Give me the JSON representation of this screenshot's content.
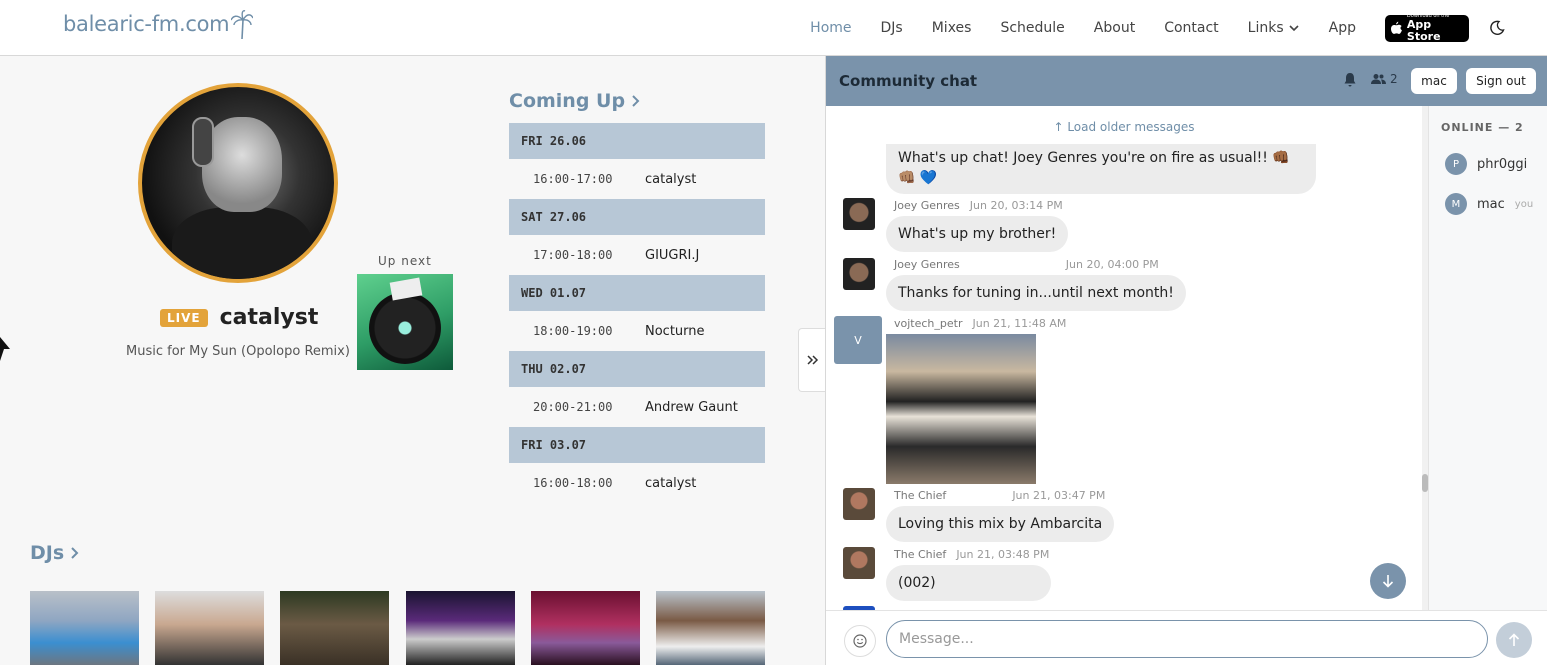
{
  "nav": {
    "logo": "balearic-fm.com",
    "links": [
      "Home",
      "DJs",
      "Mixes",
      "Schedule",
      "About",
      "Contact",
      "Links",
      "App"
    ],
    "appstore_small": "Download on the",
    "appstore_big": "App Store"
  },
  "now_playing": {
    "live_badge": "LIVE",
    "dj": "catalyst",
    "track": "Music for My Sun (Opolopo Remix)",
    "up_next_label": "Up next"
  },
  "coming_up": {
    "title": "Coming Up",
    "days": [
      {
        "day": "FRI 26.06",
        "time": "16:00-17:00",
        "dj": "catalyst"
      },
      {
        "day": "SAT 27.06",
        "time": "17:00-18:00",
        "dj": "GIUGRI.J"
      },
      {
        "day": "WED 01.07",
        "time": "18:00-19:00",
        "dj": "Nocturne"
      },
      {
        "day": "THU 02.07",
        "time": "20:00-21:00",
        "dj": "Andrew Gaunt"
      },
      {
        "day": "FRI 03.07",
        "time": "16:00-18:00",
        "dj": "catalyst"
      }
    ]
  },
  "djs": {
    "title": "DJs"
  },
  "chat": {
    "title": "Community chat",
    "user_count": "2",
    "user_button": "mac",
    "signout": "Sign out",
    "load_older": "Load older messages",
    "messages": [
      {
        "author": "",
        "time": "",
        "text": "What's up chat! Joey Genres you're on fire as usual!! 👊🏾👊🏽 💙"
      },
      {
        "author": "Joey Genres",
        "time": "Jun 20, 03:14 PM",
        "text": "What's up my brother!"
      },
      {
        "author": "Joey Genres",
        "time": "Jun 20, 04:00 PM",
        "text": "Thanks for tuning in...until next month!"
      },
      {
        "author": "vojtech_petr",
        "time": "Jun 21, 11:48 AM",
        "text": ""
      },
      {
        "author": "The Chief",
        "time": "Jun 21, 03:47 PM",
        "text": "Loving this mix by Ambarcita"
      },
      {
        "author": "The Chief",
        "time": "Jun 21, 03:48 PM",
        "text": "(002)"
      }
    ],
    "vojtech_initial": "V",
    "online_title": "ONLINE — 2",
    "online": [
      {
        "initial": "P",
        "name": "phr0ggi",
        "you": ""
      },
      {
        "initial": "M",
        "name": "mac",
        "you": "you"
      }
    ],
    "input_placeholder": "Message..."
  },
  "colors": {
    "accent": "#6f8ea8",
    "live": "#e3a33a",
    "chat_header": "#7a93ab"
  }
}
